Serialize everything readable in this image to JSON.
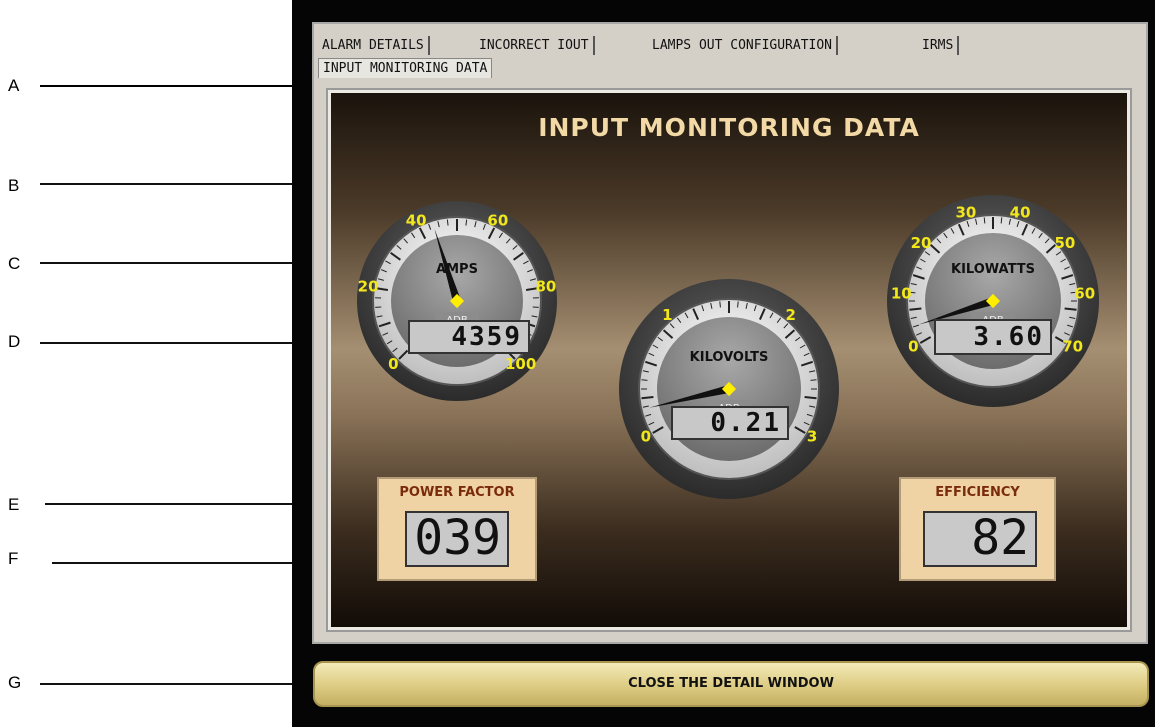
{
  "callouts": [
    "A",
    "B",
    "C",
    "D",
    "E",
    "F",
    "G"
  ],
  "tabs": [
    {
      "label": "ALARM DETAILS"
    },
    {
      "label": "INCORRECT IOUT"
    },
    {
      "label": "LAMPS OUT CONFIGURATION"
    },
    {
      "label": "IRMS"
    },
    {
      "label": "INPUT MONITORING DATA",
      "active": true
    }
  ],
  "panel": {
    "title": "INPUT MONITORING DATA",
    "gauges": [
      {
        "key": "amps",
        "label": "AMPS",
        "badge": "ADB",
        "ticks": [
          "0",
          "20",
          "40",
          "60",
          "80",
          "100"
        ],
        "min": 0,
        "max": 100,
        "value": 43.59,
        "display": "4359"
      },
      {
        "key": "kilovolts",
        "label": "KILOVOLTS",
        "badge": "ADB",
        "ticks": [
          "0",
          "1",
          "2",
          "3"
        ],
        "min": 0,
        "max": 3,
        "value": 0.21,
        "display": "0.21"
      },
      {
        "key": "kilowatts",
        "label": "KILOWATTS",
        "badge": "ADB",
        "ticks": [
          "0",
          "10",
          "20",
          "30",
          "40",
          "50",
          "60",
          "70"
        ],
        "min": 0,
        "max": 70,
        "value": 3.6,
        "display": "3.60"
      }
    ],
    "power_factor": {
      "label": "POWER FACTOR",
      "value": "039"
    },
    "efficiency": {
      "label": "EFFICIENCY",
      "value": "82"
    }
  },
  "close_button": {
    "label": "CLOSE THE DETAIL WINDOW"
  },
  "colors": {
    "title": "#f2d9a6",
    "tick_label": "#f2e71a",
    "needle": "#111111",
    "pivot": "#ffee00",
    "badge_label": "#7a2b0c",
    "button": "#dccb82"
  }
}
